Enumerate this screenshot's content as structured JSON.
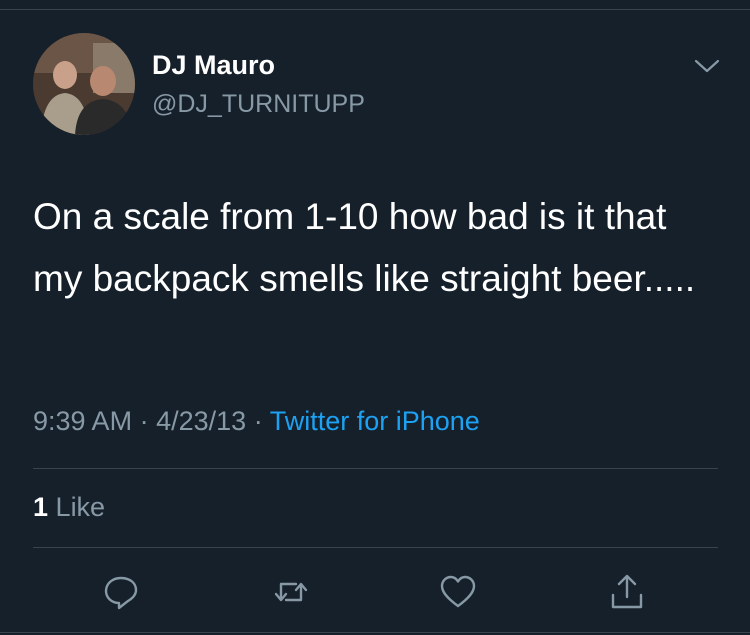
{
  "user": {
    "display_name": "DJ Mauro",
    "handle": "@DJ_TURNITUPP",
    "avatar_icon": "profile-photo-two-men"
  },
  "tweet": {
    "text": "On a scale from 1-10 how bad is it that my backpack smells like straight beer.....",
    "time": "9:39 AM",
    "separator": "·",
    "date": "4/23/13",
    "source": "Twitter for iPhone"
  },
  "stats": {
    "like_count": "1",
    "like_label": "Like"
  },
  "actions": [
    "reply-icon",
    "retweet-icon",
    "like-icon",
    "share-icon"
  ],
  "colors": {
    "background": "#15202b",
    "text": "#ffffff",
    "muted": "#8899a6",
    "link": "#1da1f2",
    "divider": "#38444d"
  }
}
